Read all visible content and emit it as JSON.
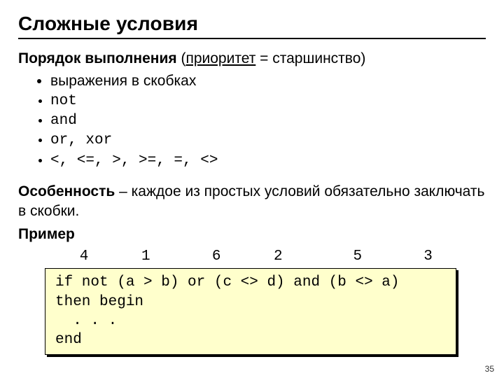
{
  "title": "Сложные условия",
  "priority": {
    "lead_bold": "Порядок выполнения",
    "paren_open": " (",
    "underlined": "приоритет",
    "paren_rest": " = старшинство)",
    "items_plain": [
      "выражения в скобках"
    ],
    "items_mono": [
      "not",
      "and",
      "or, xor",
      "<, <=, >, >=, =, <>"
    ]
  },
  "feature": {
    "bold": "Особенность",
    "rest": " – каждое из простых условий обязательно заключать в скобки."
  },
  "example": {
    "heading": "Пример",
    "numbers_line": "   4      1       6      2        5       3",
    "code_lines": [
      "if not (a > b) or (c <> d) and (b <> a)",
      "then begin",
      "  . . .",
      "end"
    ]
  },
  "page_number": "35"
}
